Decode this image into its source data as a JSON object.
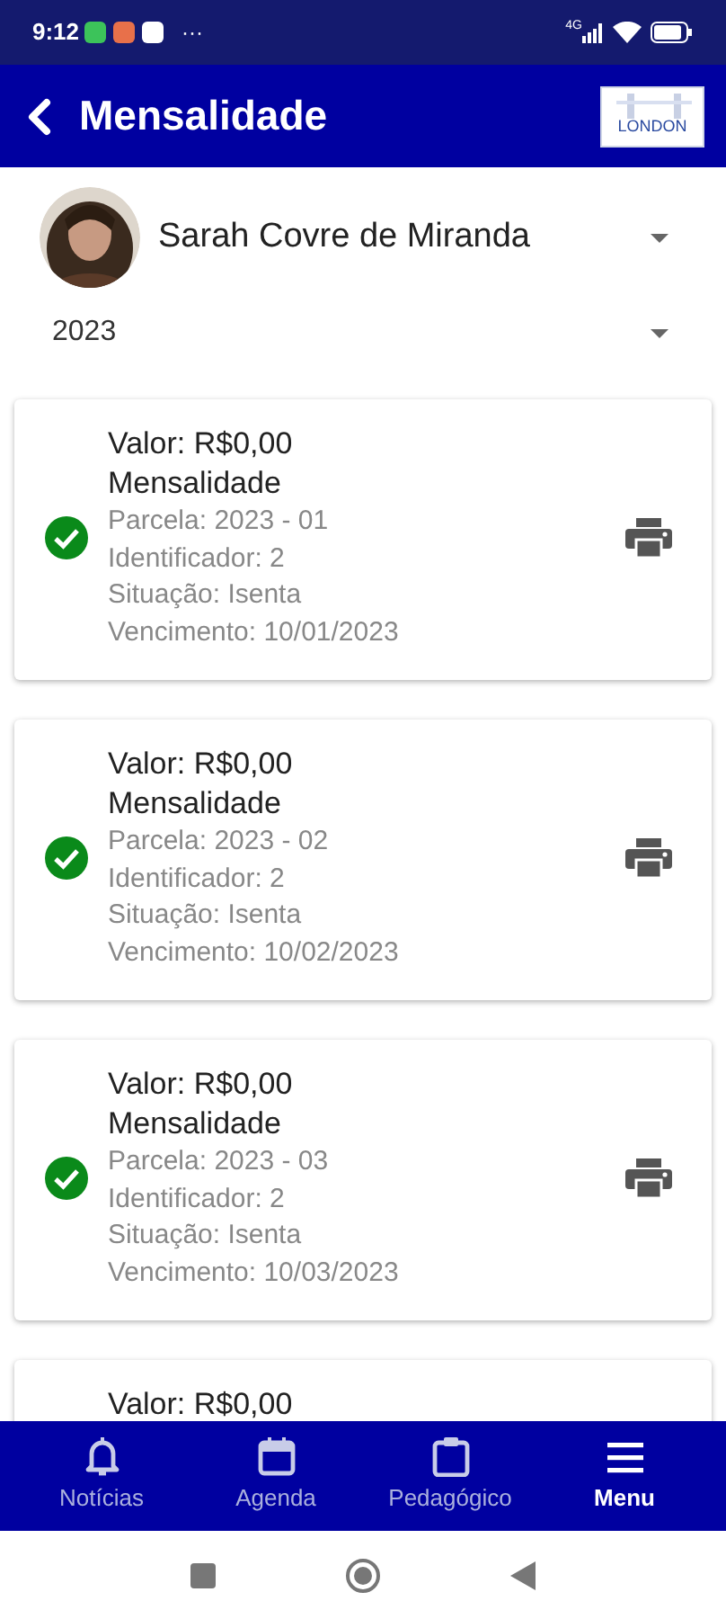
{
  "status_bar": {
    "time": "9:12",
    "more": "···",
    "network": "4G"
  },
  "header": {
    "title": "Mensalidade",
    "logo_text": "LONDON"
  },
  "student": {
    "name": "Sarah Covre de Miranda"
  },
  "year": {
    "value": "2023"
  },
  "installments": [
    {
      "value": "Valor: R$0,00",
      "type": "Mensalidade",
      "parcela": "Parcela: 2023 - 01",
      "identificador": "Identificador: 2",
      "situacao": "Situação: Isenta",
      "vencimento": "Vencimento: 10/01/2023",
      "paid": true
    },
    {
      "value": "Valor: R$0,00",
      "type": "Mensalidade",
      "parcela": "Parcela: 2023 - 02",
      "identificador": "Identificador: 2",
      "situacao": "Situação: Isenta",
      "vencimento": "Vencimento: 10/02/2023",
      "paid": true
    },
    {
      "value": "Valor: R$0,00",
      "type": "Mensalidade",
      "parcela": "Parcela: 2023 - 03",
      "identificador": "Identificador: 2",
      "situacao": "Situação: Isenta",
      "vencimento": "Vencimento: 10/03/2023",
      "paid": true
    },
    {
      "value": "Valor: R$0,00"
    }
  ],
  "bottom_nav": [
    {
      "label": "Notícias",
      "selected": false
    },
    {
      "label": "Agenda",
      "selected": false
    },
    {
      "label": "Pedagógico",
      "selected": false
    },
    {
      "label": "Menu",
      "selected": true
    }
  ]
}
